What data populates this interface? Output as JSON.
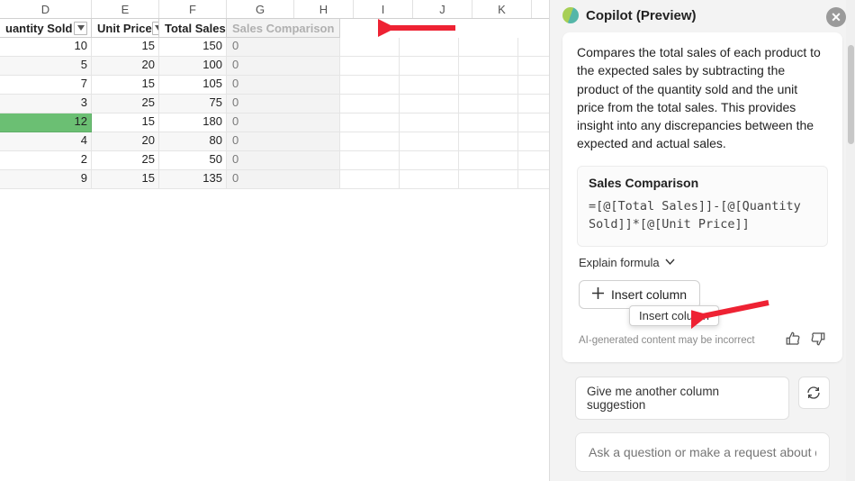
{
  "cols": [
    "D",
    "E",
    "F",
    "G",
    "H",
    "I",
    "J",
    "K"
  ],
  "table": {
    "headers": [
      "uantity Sold",
      "Unit Price",
      "Total Sales"
    ],
    "ghost_header": "Sales Comparison",
    "rows": [
      {
        "qty": 10,
        "price": 15,
        "total": 150,
        "ins": "0",
        "hl": false
      },
      {
        "qty": 5,
        "price": 20,
        "total": 100,
        "ins": "0",
        "hl": false
      },
      {
        "qty": 7,
        "price": 15,
        "total": 105,
        "ins": "0",
        "hl": false
      },
      {
        "qty": 3,
        "price": 25,
        "total": 75,
        "ins": "0",
        "hl": false
      },
      {
        "qty": 12,
        "price": 15,
        "total": 180,
        "ins": "0",
        "hl": true
      },
      {
        "qty": 4,
        "price": 20,
        "total": 80,
        "ins": "0",
        "hl": false
      },
      {
        "qty": 2,
        "price": 25,
        "total": 50,
        "ins": "0",
        "hl": false
      },
      {
        "qty": 9,
        "price": 15,
        "total": 135,
        "ins": "0",
        "hl": false
      }
    ]
  },
  "copilot": {
    "title": "Copilot (Preview)",
    "description": "Compares the total sales of each product to the expected sales by subtracting the product of the quantity sold and the unit price from the total sales. This provides insight into any discrepancies between the expected and actual sales.",
    "formula_title": "Sales Comparison",
    "formula_code": "=[@[Total Sales]]-[@[Quantity Sold]]*[@[Unit Price]]",
    "explain_label": "Explain formula",
    "insert_label": "Insert column",
    "tooltip": "Insert column",
    "disclaimer": "AI-generated content may be incorrect",
    "suggest_label": "Give me another column suggestion",
    "ask_placeholder": "Ask a question or make a request about data in a table"
  }
}
